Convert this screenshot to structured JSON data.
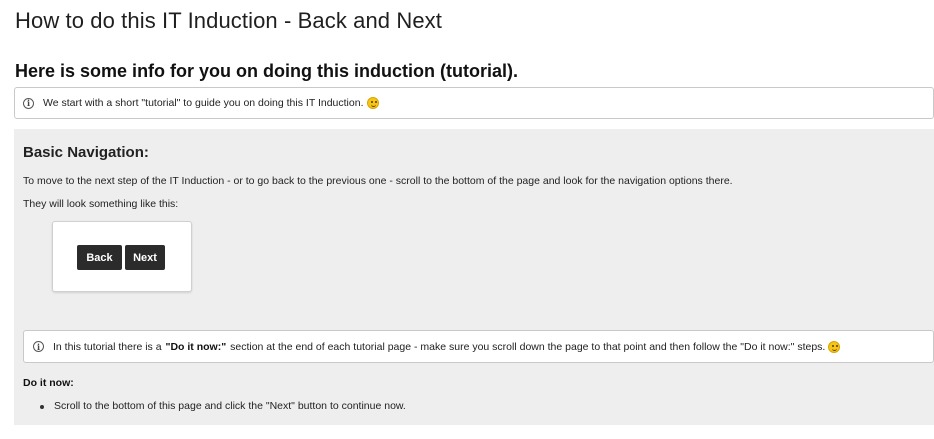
{
  "page": {
    "title": "How to do this IT Induction - Back and Next",
    "section_heading": "Here is some info for you on doing this induction (tutorial)."
  },
  "info_box": {
    "icon": "info-icon",
    "text": "We start with a short \"tutorial\" to guide you on doing this IT Induction.",
    "emoji": "smiley-emoji"
  },
  "panel": {
    "heading": "Basic Navigation:",
    "paragraph1": "To move to the next step of the IT Induction - or to go back to the previous one - scroll to the bottom of the page and look for the navigation options there.",
    "paragraph2": "They will look something like this:",
    "example_buttons": {
      "back_label": "Back",
      "next_label": "Next"
    },
    "tip": {
      "icon": "info-icon",
      "text_before": "In this tutorial there is a",
      "bold": "\"Do it now:\"",
      "text_after": "section at the end of each tutorial page - make sure you scroll down the page to that point and then follow the \"Do it now:\" steps.",
      "emoji": "smiley-emoji"
    },
    "do_it_now": {
      "heading": "Do it now:",
      "items": [
        "Scroll to the bottom of this page and click the \"Next\" button to continue now."
      ]
    }
  },
  "colors": {
    "panel_background": "#eeeeee",
    "button_background": "#2b2b2b",
    "border": "#c9c9c9"
  }
}
